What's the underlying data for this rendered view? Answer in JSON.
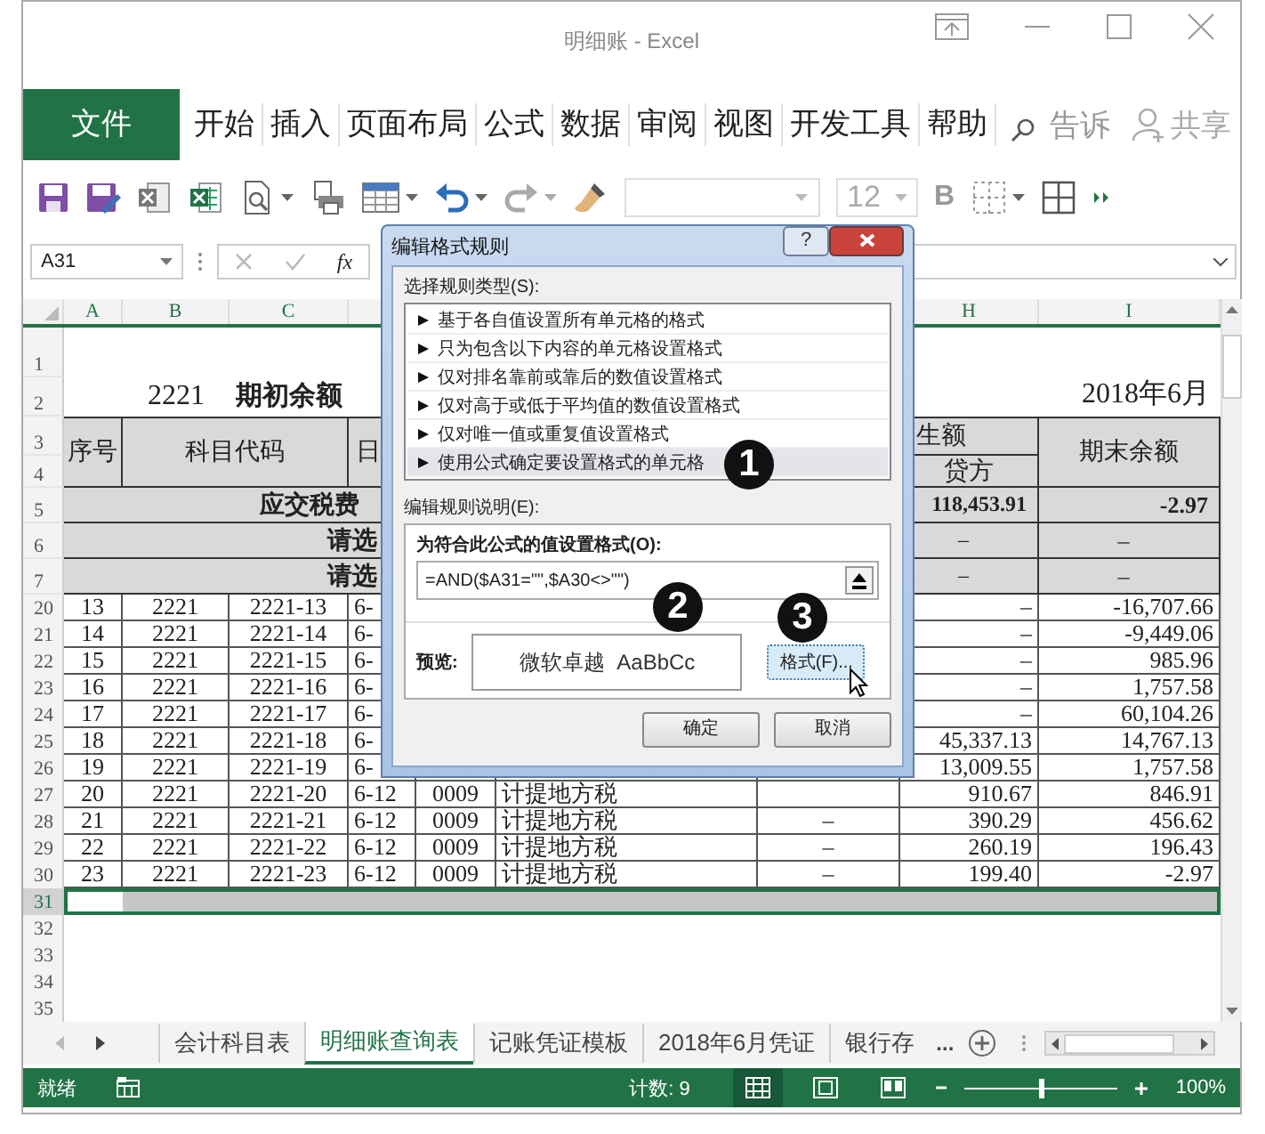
{
  "window": {
    "title": "明细账  -  Excel"
  },
  "ribbon_tabs": [
    {
      "label": "文件",
      "kind": "file"
    },
    {
      "label": "开始",
      "kind": "tab"
    },
    {
      "label": "插入",
      "kind": "tab"
    },
    {
      "label": "页面布局",
      "kind": "tab"
    },
    {
      "label": "公式",
      "kind": "tab"
    },
    {
      "label": "数据",
      "kind": "tab"
    },
    {
      "label": "审阅",
      "kind": "tab"
    },
    {
      "label": "视图",
      "kind": "tab"
    },
    {
      "label": "开发工具",
      "kind": "tab"
    },
    {
      "label": "帮助",
      "kind": "tab"
    }
  ],
  "tell_me": "告诉",
  "share": "共享",
  "toolbar": {
    "font_size": "12",
    "bold": "B"
  },
  "formula_bar": {
    "name_box": "A31",
    "function_label": "fx"
  },
  "sheet": {
    "column_headers": [
      "A",
      "B",
      "C",
      "H",
      "I"
    ],
    "header_rows": {
      "numbers": [
        "1",
        "2",
        "3",
        "4",
        "5",
        "6",
        "7"
      ],
      "account": "2221",
      "opening_label": "期初余额",
      "period": "2018年6月",
      "seq": "序号",
      "sub_code": "科目代码",
      "date": "日",
      "amount_group": "生额",
      "credit": "贷方",
      "balance": "期末余额"
    },
    "summary_rows": [
      {
        "label": "应交税费",
        "kind": "total",
        "credit": "118,453.91",
        "balance": "-2.97"
      },
      {
        "label": "请选",
        "kind": "filter",
        "credit": "–",
        "balance": "–"
      },
      {
        "label": "请选",
        "kind": "filter",
        "credit": "–",
        "balance": "–"
      }
    ],
    "rows": [
      {
        "row": "20",
        "selected": false,
        "seq": "13",
        "account": "2221",
        "sub_code": "2221-13",
        "date": "6-",
        "credit": "–",
        "balance": "-16,707.66"
      },
      {
        "row": "21",
        "selected": false,
        "seq": "14",
        "account": "2221",
        "sub_code": "2221-14",
        "date": "6-",
        "credit": "–",
        "balance": "-9,449.06"
      },
      {
        "row": "22",
        "selected": false,
        "seq": "15",
        "account": "2221",
        "sub_code": "2221-15",
        "date": "6-",
        "credit": "–",
        "balance": "985.96"
      },
      {
        "row": "23",
        "selected": false,
        "seq": "16",
        "account": "2221",
        "sub_code": "2221-16",
        "date": "6-",
        "credit": "–",
        "balance": "1,757.58"
      },
      {
        "row": "24",
        "selected": false,
        "seq": "17",
        "account": "2221",
        "sub_code": "2221-17",
        "date": "6-",
        "credit": "–",
        "balance": "60,104.26"
      },
      {
        "row": "25",
        "selected": false,
        "seq": "18",
        "account": "2221",
        "sub_code": "2221-18",
        "date": "6-",
        "credit": "45,337.13",
        "balance": "14,767.13"
      },
      {
        "row": "26",
        "selected": false,
        "seq": "19",
        "account": "2221",
        "sub_code": "2221-19",
        "date": "6-",
        "credit": "13,009.55",
        "balance": "1,757.58"
      },
      {
        "row": "27",
        "selected": false,
        "seq": "20",
        "account": "2221",
        "sub_code": "2221-20",
        "date": "6-12",
        "voucher": "0009",
        "summary": "计提地方税",
        "credit": "910.67",
        "balance": "846.91"
      },
      {
        "row": "28",
        "selected": false,
        "seq": "21",
        "account": "2221",
        "sub_code": "2221-21",
        "date": "6-12",
        "voucher": "0009",
        "summary": "计提地方税",
        "column_g": "–",
        "credit": "390.29",
        "balance": "456.62"
      },
      {
        "row": "29",
        "selected": false,
        "seq": "22",
        "account": "2221",
        "sub_code": "2221-22",
        "date": "6-12",
        "voucher": "0009",
        "summary": "计提地方税",
        "column_g": "–",
        "credit": "260.19",
        "balance": "196.43"
      },
      {
        "row": "30",
        "selected": false,
        "seq": "23",
        "account": "2221",
        "sub_code": "2221-23",
        "date": "6-12",
        "voucher": "0009",
        "summary": "计提地方税",
        "column_g": "–",
        "credit": "199.40",
        "balance": "-2.97"
      },
      {
        "row": "31",
        "selected": true
      },
      {
        "row": "32",
        "selected": false
      },
      {
        "row": "33",
        "selected": false
      },
      {
        "row": "34",
        "selected": false
      },
      {
        "row": "35",
        "selected": false
      }
    ]
  },
  "sheet_tabs": [
    {
      "label": "会计科目表",
      "selected": false
    },
    {
      "label": "明细账查询表",
      "selected": true
    },
    {
      "label": "记账凭证模板",
      "selected": false
    },
    {
      "label": "2018年6月凭证",
      "selected": false
    },
    {
      "label": "银行存",
      "selected": false
    }
  ],
  "more_tabs": "...",
  "status_bar": {
    "status": "就绪",
    "count": "计数: 9",
    "views": [
      {
        "kind": "normal",
        "selected": true
      },
      {
        "kind": "page_layout",
        "selected": false
      },
      {
        "kind": "page_break",
        "selected": false
      }
    ],
    "zoom": {
      "level": 0.5,
      "reading": "100%"
    }
  },
  "dialog": {
    "title": "编辑格式规则",
    "help": "?",
    "rule_type_label": "选择规则类型(S):",
    "rule_types": [
      {
        "label": "基于各自值设置所有单元格的格式",
        "selected": false
      },
      {
        "label": "只为包含以下内容的单元格设置格式",
        "selected": false
      },
      {
        "label": "仅对排名靠前或靠后的数值设置格式",
        "selected": false
      },
      {
        "label": "仅对高于或低于平均值的数值设置格式",
        "selected": false
      },
      {
        "label": "仅对唯一值或重复值设置格式",
        "selected": false
      },
      {
        "label": "使用公式确定要设置格式的单元格",
        "selected": true
      }
    ],
    "description_label": "编辑规则说明(E):",
    "formula_label": "为符合此公式的值设置格式(O):",
    "formula": "=AND($A31=\"\",$A30<>\"\")",
    "preview_label": "预览:",
    "preview_text": "微软卓越  AaBbCc",
    "format_button": "格式(F)...",
    "ok": "确定",
    "cancel": "取消",
    "callouts": [
      "1",
      "2",
      "3"
    ]
  }
}
